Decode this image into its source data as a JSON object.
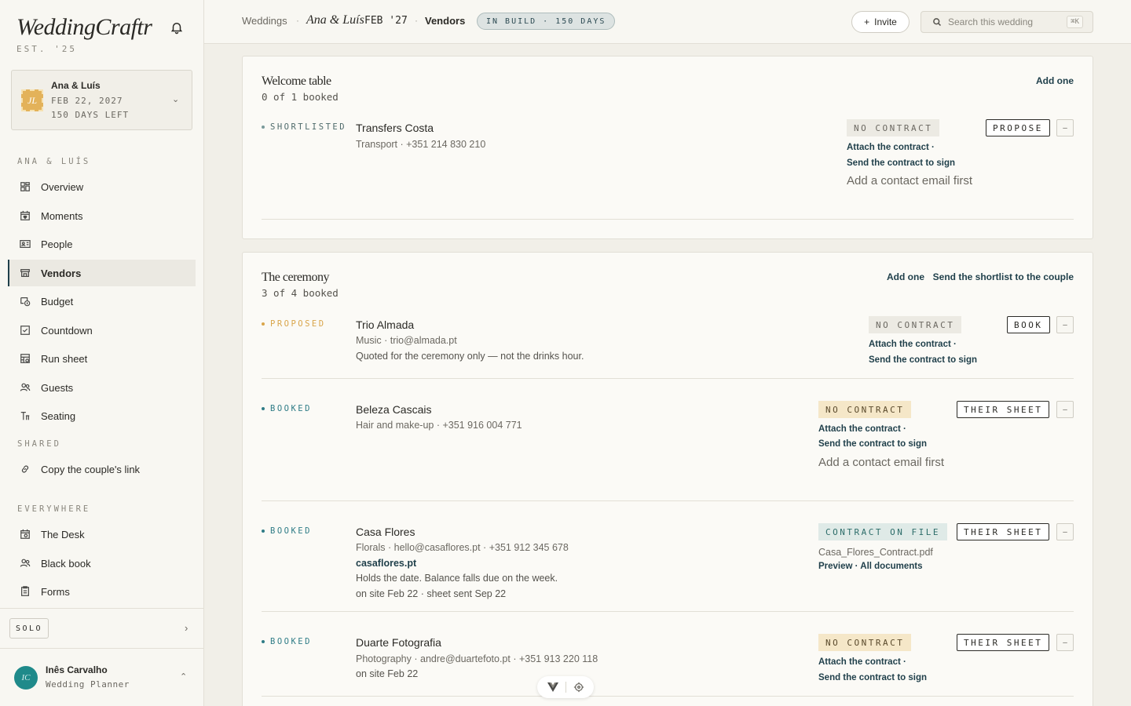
{
  "brand": {
    "name": "WeddingCraftr",
    "est": "EST. '25"
  },
  "wedding_switcher": {
    "monogram": "JL",
    "couple": "Ana & Luís",
    "date": "FEB 22, 2027",
    "days_left": "150 DAYS LEFT"
  },
  "sidebar": {
    "section_couple": "ANA & LUÍS",
    "items": [
      {
        "label": "Overview",
        "icon": "grid-icon"
      },
      {
        "label": "Moments",
        "icon": "calendar-heart-icon"
      },
      {
        "label": "People",
        "icon": "id-card-icon"
      },
      {
        "label": "Vendors",
        "icon": "storefront-icon",
        "active": true
      },
      {
        "label": "Budget",
        "icon": "coins-icon"
      },
      {
        "label": "Countdown",
        "icon": "checklist-icon"
      },
      {
        "label": "Run sheet",
        "icon": "sheet-icon"
      },
      {
        "label": "Guests",
        "icon": "guests-icon"
      },
      {
        "label": "Seating",
        "icon": "seating-icon"
      }
    ],
    "section_shared": "SHARED",
    "shared_items": [
      {
        "label": "Copy the couple's link",
        "icon": "link-icon"
      }
    ],
    "section_everywhere": "EVERYWHERE",
    "everywhere_items": [
      {
        "label": "The Desk",
        "icon": "desk-icon"
      },
      {
        "label": "Black book",
        "icon": "contacts-icon"
      },
      {
        "label": "Forms",
        "icon": "form-icon"
      }
    ],
    "mode": "SOLO",
    "user": {
      "initials": "IC",
      "name": "Inês Carvalho",
      "role": "Wedding Planner"
    }
  },
  "topbar": {
    "crumb_root": "Weddings",
    "crumb_couple": "Ana & Luís",
    "crumb_date": "FEB '27",
    "crumb_page": "Vendors",
    "build_status": "IN BUILD · 150 DAYS",
    "invite_label": "Invite",
    "search_placeholder": "Search this wedding",
    "search_kbd": "⌘K"
  },
  "sections": [
    {
      "title": "Welcome table",
      "booked": "0 of 1 booked",
      "links": [
        "Add one"
      ],
      "vendors": [
        {
          "status": "SHORTLISTED",
          "status_color": "#7a9a9a",
          "name": "Transfers Costa",
          "meta": "Transport · +351 214 830 210",
          "contract": "NO CONTRACT",
          "contract_style": "gray",
          "action": "PROPOSE",
          "attach": "Attach the contract ·",
          "send": "Send the contract to sign",
          "hint": "Add a contact email first"
        }
      ]
    },
    {
      "title": "The ceremony",
      "booked": "3 of 4 booked",
      "links": [
        "Add one",
        "Send the shortlist to the couple"
      ],
      "vendors": [
        {
          "status": "PROPOSED",
          "status_color": "#d9a54a",
          "name": "Trio Almada",
          "meta": "Music · trio@almada.pt",
          "note": "Quoted for the ceremony only — not the drinks hour.",
          "contract": "NO CONTRACT",
          "contract_style": "gray",
          "action": "BOOK",
          "attach": "Attach the contract ·",
          "send": "Send the contract to sign"
        },
        {
          "status": "BOOKED",
          "status_color": "#2f7c86",
          "name": "Beleza Cascais",
          "meta": "Hair and make-up · +351 916 004 771",
          "contract": "NO CONTRACT",
          "contract_style": "tan",
          "action": "THEIR SHEET",
          "attach": "Attach the contract ·",
          "send": "Send the contract to sign",
          "hint": "Add a contact email first"
        },
        {
          "status": "BOOKED",
          "status_color": "#2f7c86",
          "name": "Casa Flores",
          "meta": "Florals · hello@casaflores.pt · +351 912 345 678",
          "website": "casaflores.pt",
          "note": "Holds the date. Balance falls due on the week.",
          "onsite": "on site Feb 22 · sheet sent Sep 22",
          "contract": "CONTRACT ON FILE",
          "contract_style": "teal",
          "action": "THEIR SHEET",
          "file": "Casa_Flores_Contract.pdf",
          "file_links": "Preview · All documents"
        },
        {
          "status": "BOOKED",
          "status_color": "#2f7c86",
          "name": "Duarte Fotografia",
          "meta": "Photography · andre@duartefoto.pt · +351 913 220 118",
          "onsite": "on site Feb 22",
          "contract": "NO CONTRACT",
          "contract_style": "tan",
          "action": "THEIR SHEET",
          "attach": "Attach the contract ·",
          "send": "Send the contract to sign"
        }
      ]
    }
  ],
  "more_button": "–",
  "colors": {
    "accent": "#1f3f4a",
    "booked": "#2f7c86",
    "proposed": "#d9a54a",
    "shortlisted": "#7a9a9a",
    "stamp": "#e3b25a",
    "avatar": "#1f8a8a"
  }
}
